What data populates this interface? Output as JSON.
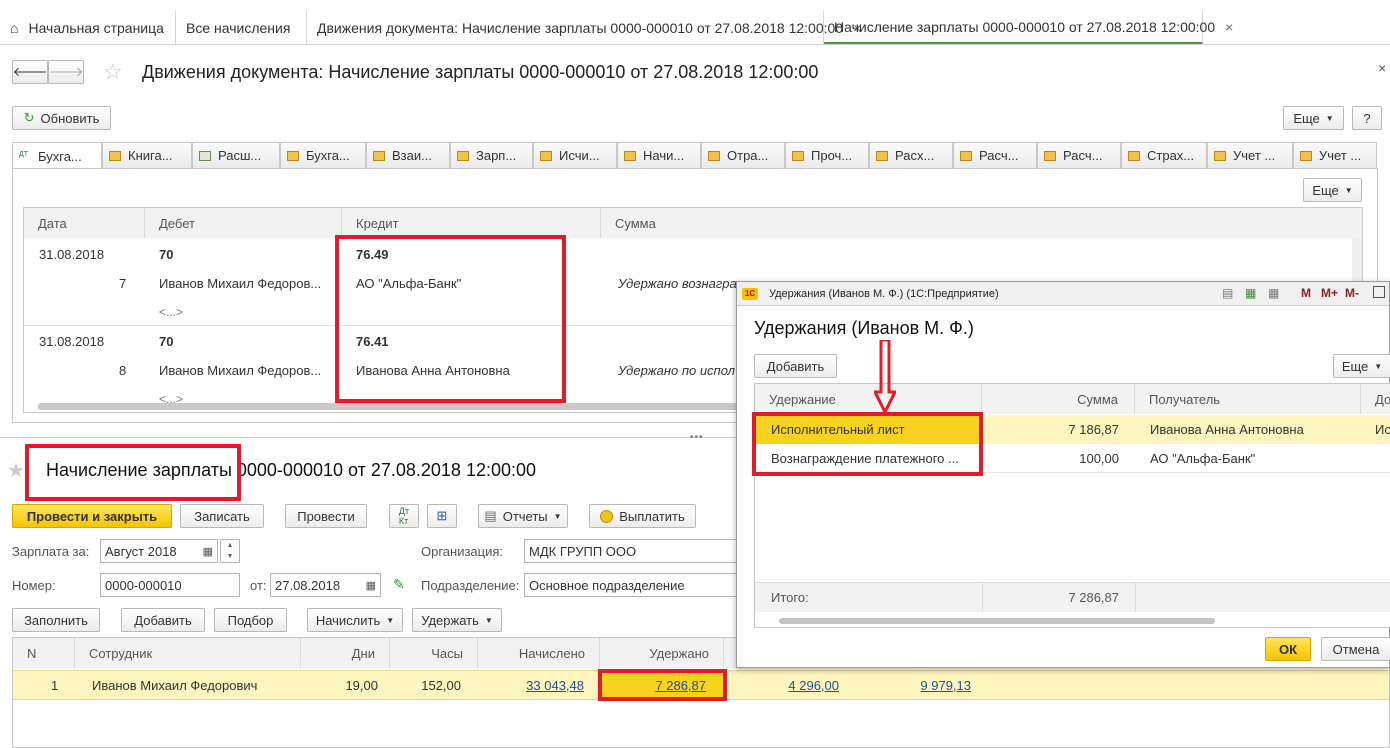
{
  "tabs": [
    {
      "label": "Начальная страница"
    },
    {
      "label": "Все начисления"
    },
    {
      "label": "Движения документа: Начисление зарплаты 0000-000010 от 27.08.2018 12:00:00"
    },
    {
      "label": "Начисление зарплаты 0000-000010 от 27.08.2018 12:00:00"
    }
  ],
  "movements": {
    "title": "Движения документа: Начисление зарплаты 0000-000010 от 27.08.2018 12:00:00",
    "refresh_label": "Обновить",
    "more_label": "Еще",
    "help_label": "?",
    "subtabs": [
      "Бухга...",
      "Книга...",
      "Расш...",
      "Бухга...",
      "Взаи...",
      "Зарп...",
      "Исчи...",
      "Начи...",
      "Отра...",
      "Проч...",
      "Расх...",
      "Расч...",
      "Расч...",
      "Страх...",
      "Учет ...",
      "Учет ..."
    ],
    "columns": [
      "Дата",
      "Дебет",
      "Кредит",
      "Сумма"
    ],
    "rows": [
      {
        "date": "31.08.2018",
        "num": "7",
        "debit": "70",
        "debit_sub": "Иванов Михаил Федоров...",
        "debit_more": "<...>",
        "credit": "76.49",
        "credit_sub": "АО \"Альфа-Банк\"",
        "sum_note": "Удержано вознагра"
      },
      {
        "date": "31.08.2018",
        "num": "8",
        "debit": "70",
        "debit_sub": "Иванов Михаил Федоров...",
        "debit_more": "<...>",
        "credit": "76.41",
        "credit_sub": "Иванова Анна Антоновна",
        "sum_note": "Удержано по испол"
      }
    ]
  },
  "document": {
    "title_part1": "Начисление зарплаты",
    "title_part2": " 0000-000010 от 27.08.2018 12:00:00",
    "buttons": {
      "post_close": "Провести и закрыть",
      "save": "Записать",
      "post": "Провести",
      "reports": "Отчеты",
      "pay": "Выплатить"
    },
    "salary_for_label": "Зарплата за:",
    "salary_for_value": "Август 2018",
    "org_label": "Организация:",
    "org_value": "МДК ГРУПП ООО",
    "number_label": "Номер:",
    "number_value": "0000-000010",
    "date_label": "от:",
    "date_value": "27.08.2018",
    "division_label": "Подразделение:",
    "division_value": "Основное подразделение",
    "table_buttons": {
      "fill": "Заполнить",
      "add": "Добавить",
      "select": "Подбор",
      "accrue": "Начислить",
      "withhold": "Удержать"
    },
    "columns": [
      "N",
      "Сотрудник",
      "Дни",
      "Часы",
      "Начислено",
      "Удержано"
    ],
    "row": {
      "n": "1",
      "employee": "Иванов Михаил Федорович",
      "days": "19,00",
      "hours": "152,00",
      "accrued": "33 043,48",
      "withheld": "7 286,87",
      "col7": "4 296,00",
      "col8": "9 979,13"
    }
  },
  "popup": {
    "window_title": "Удержания (Иванов М. Ф.) (1С:Предприятие)",
    "title": "Удержания (Иванов М. Ф.)",
    "add_label": "Добавить",
    "more_label": "Еще",
    "columns": [
      "Удержание",
      "Сумма",
      "Получатель",
      "До"
    ],
    "rows": [
      {
        "name": "Исполнительный лист",
        "sum": "7 186,87",
        "recipient": "Иванова Анна Антоновна",
        "extra": "Ис"
      },
      {
        "name": "Вознаграждение платежного ...",
        "sum": "100,00",
        "recipient": "АО \"Альфа-Банк\"",
        "extra": ""
      }
    ],
    "total_label": "Итого:",
    "total_value": "7 286,87",
    "ok_label": "ОК",
    "cancel_label": "Отмена",
    "toolbar_m": "M",
    "toolbar_mplus": "M+",
    "toolbar_mminus": "M-"
  }
}
